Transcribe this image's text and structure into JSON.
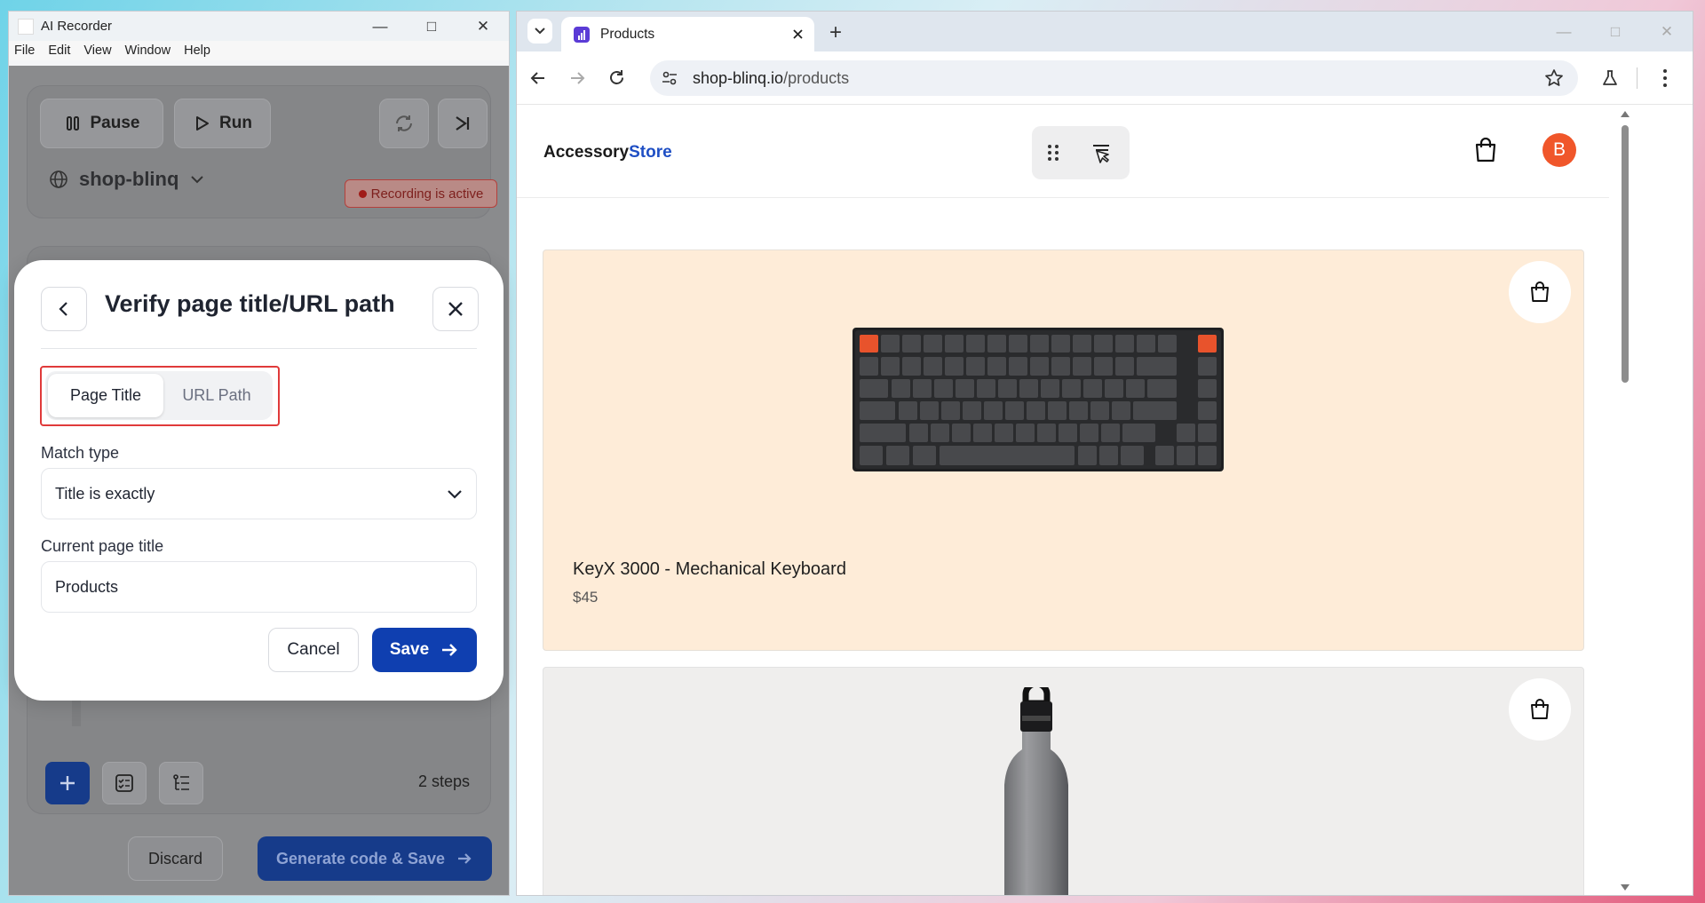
{
  "recorder": {
    "title": "AI Recorder",
    "menu": [
      "File",
      "Edit",
      "View",
      "Window",
      "Help"
    ],
    "pause_label": "Pause",
    "run_label": "Run",
    "site_name": "shop-blinq",
    "recording_status": "Recording is active",
    "steps_count": "2 steps",
    "discard_label": "Discard",
    "generate_label": "Generate code & Save"
  },
  "modal": {
    "title": "Verify page title/URL path",
    "tabs": [
      "Page Title",
      "URL Path"
    ],
    "active_tab": "Page Title",
    "match_type_label": "Match type",
    "match_type_value": "Title is exactly",
    "current_title_label": "Current page title",
    "current_title_value": "Products",
    "cancel_label": "Cancel",
    "save_label": "Save"
  },
  "browser": {
    "tab_title": "Products",
    "url_host": "shop-blinq.io",
    "url_path": "/products"
  },
  "store": {
    "logo_part1": "Accessory",
    "logo_part2": "Store",
    "avatar_initial": "B",
    "products": [
      {
        "name": "KeyX 3000 - Mechanical Keyboard",
        "price": "$45"
      }
    ]
  },
  "colors": {
    "accent_blue": "#0f3fb0",
    "recording_red": "#b4403c",
    "avatar_orange": "#f0562a",
    "card1_bg": "#feecd8",
    "card2_bg": "#efeeed"
  }
}
